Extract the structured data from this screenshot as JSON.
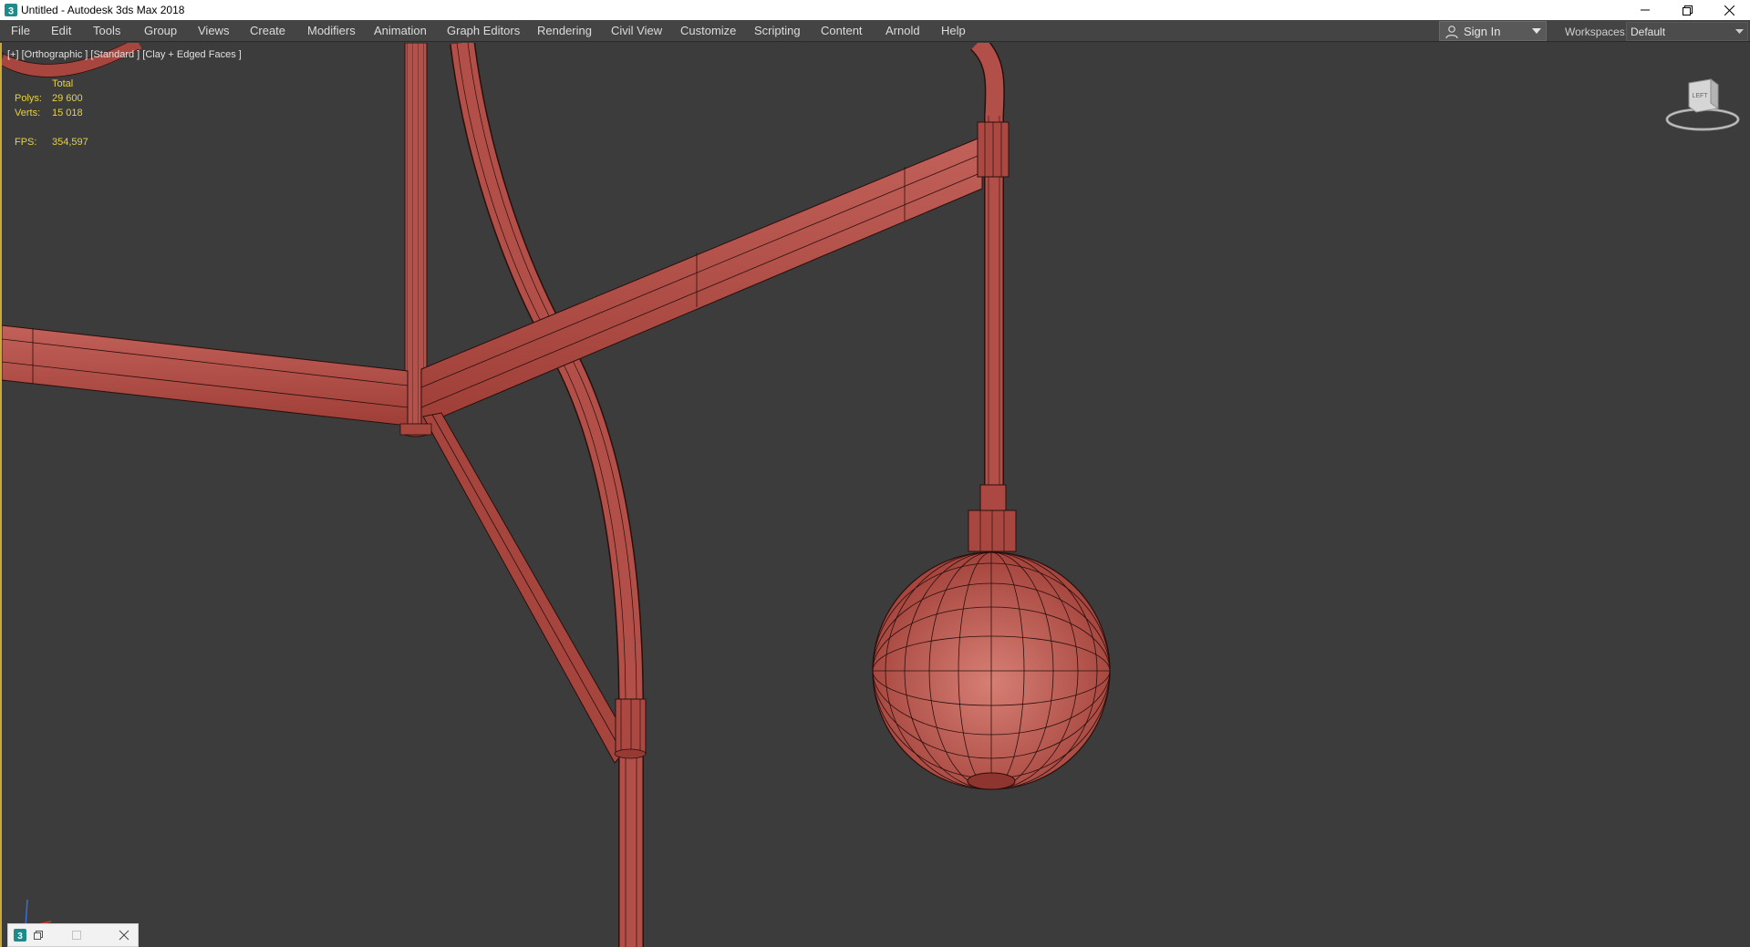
{
  "window": {
    "title": "Untitled - Autodesk 3ds Max 2018",
    "app_icon": "3dsmax-logo-icon",
    "controls": [
      "minimize-icon",
      "restore-icon",
      "close-icon"
    ]
  },
  "menu": {
    "items": [
      {
        "label": "File",
        "name": "menu-file"
      },
      {
        "label": "Edit",
        "name": "menu-edit"
      },
      {
        "label": "Tools",
        "name": "menu-tools"
      },
      {
        "label": "Group",
        "name": "menu-group"
      },
      {
        "label": "Views",
        "name": "menu-views"
      },
      {
        "label": "Create",
        "name": "menu-create"
      },
      {
        "label": "Modifiers",
        "name": "menu-modifiers"
      },
      {
        "label": "Animation",
        "name": "menu-animation"
      },
      {
        "label": "Graph Editors",
        "name": "menu-graph-editors"
      },
      {
        "label": "Rendering",
        "name": "menu-rendering"
      },
      {
        "label": "Civil View",
        "name": "menu-civil-view"
      },
      {
        "label": "Customize",
        "name": "menu-customize"
      },
      {
        "label": "Scripting",
        "name": "menu-scripting"
      },
      {
        "label": "Content",
        "name": "menu-content"
      },
      {
        "label": "Arnold",
        "name": "menu-arnold"
      },
      {
        "label": "Help",
        "name": "menu-help"
      }
    ],
    "sign_in": "Sign In",
    "workspaces_label": "Workspaces:",
    "workspace_value": "Default"
  },
  "viewport": {
    "label": "[+] [Orthographic ] [Standard ] [Clay + Edged Faces ]",
    "stats": {
      "header": "Total",
      "polys_label": "Polys:",
      "polys_value": "29 600",
      "verts_label": "Verts:",
      "verts_value": "15 018",
      "fps_label": "FPS:",
      "fps_value": "354,597"
    },
    "viewcube_label": "LEFT",
    "colors": {
      "background": "#3c3c3c",
      "clay": "#b9544c",
      "wire": "#2a0f0c",
      "stats_text": "#e8d23c",
      "active_border": "#c8a93a"
    }
  },
  "minimized_tab": {
    "icons": [
      "3dsmax-logo-icon",
      "restore-icon",
      "maximize-icon",
      "close-icon"
    ]
  }
}
